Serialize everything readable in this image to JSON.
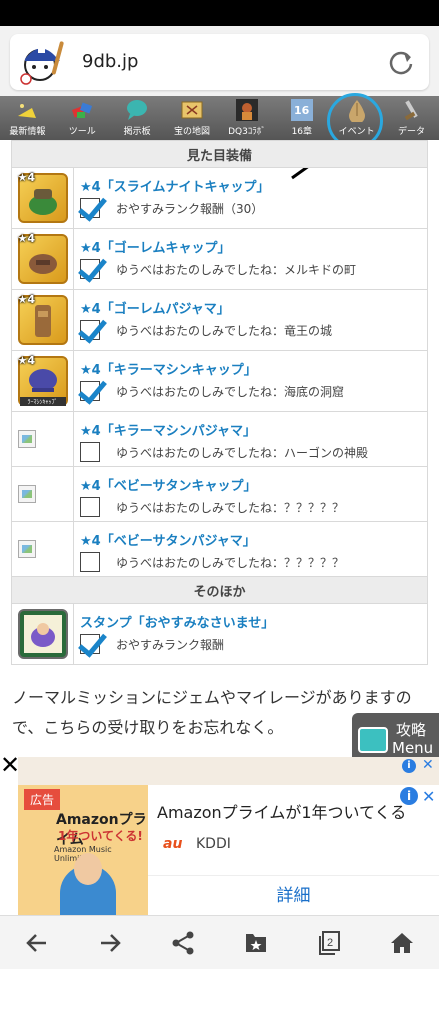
{
  "browser": {
    "url": "9db.jp"
  },
  "nav": [
    {
      "label": "最新情報",
      "icon": "news-icon"
    },
    {
      "label": "ツール",
      "icon": "tools-icon"
    },
    {
      "label": "掲示板",
      "icon": "forum-icon"
    },
    {
      "label": "宝の地図",
      "icon": "treasure-map-icon"
    },
    {
      "label": "DQ3ｺﾗﾎﾞ",
      "icon": "dq3-collab-icon"
    },
    {
      "label": "16章",
      "icon": "chapter16-icon"
    },
    {
      "label": "イベント",
      "icon": "event-icon"
    },
    {
      "label": "データ",
      "icon": "data-icon"
    }
  ],
  "sections": {
    "appearance": "見た目装備",
    "other": "そのほか"
  },
  "items": [
    {
      "title": "★4「スライムナイトキャップ」",
      "desc": "おやすみランク報酬（30）",
      "checked": true,
      "star": "★4"
    },
    {
      "title": "★4「ゴーレムキャップ」",
      "desc": "ゆうべはおたのしみでしたね：メルキドの町",
      "checked": true,
      "star": "★4"
    },
    {
      "title": "★4「ゴーレムパジャマ」",
      "desc": "ゆうべはおたのしみでしたね：竜王の城",
      "checked": true,
      "star": "★4"
    },
    {
      "title": "★4「キラーマシンキャップ」",
      "desc": "ゆうべはおたのしみでしたね：海底の洞窟",
      "checked": true,
      "star": "★4",
      "caption": "ﾗｰﾏｼﾝｷｬｯﾌﾟ"
    },
    {
      "title": "★4「キラーマシンパジャマ」",
      "desc": "ゆうべはおたのしみでしたね：ハーゴンの神殿",
      "checked": false
    },
    {
      "title": "★4「ベビーサタンキャップ」",
      "desc": "ゆうべはおたのしみでしたね：？？？？？",
      "checked": false
    },
    {
      "title": "★4「ベビーサタンパジャマ」",
      "desc": "ゆうべはおたのしみでしたね：？？？？？",
      "checked": false
    }
  ],
  "stamp": {
    "title": "スタンプ「おやすみなさいませ」",
    "desc": "おやすみランク報酬",
    "checked": true
  },
  "paragraph": "ノーマルミッションにジェムやマイレージがありますので、こちらの受け取りをお忘れなく。",
  "menu_button": {
    "top": "攻略",
    "bottom": "Menu"
  },
  "ad": {
    "label": "広告",
    "img_line1": "Amazonプライム",
    "img_line2": "1年ついてくる!",
    "img_line3": "Amazon Music Unlimited",
    "title": "Amazonプライムが1年ついてくる",
    "brand": "au",
    "advertiser": "KDDI",
    "cta": "詳細"
  },
  "bottom_bar": [
    "back-icon",
    "forward-icon",
    "share-icon",
    "bookmark-icon",
    "tabs-icon",
    "home-icon"
  ],
  "bottom_tabs_count": "2",
  "colors": {
    "link": "#1a7fc0",
    "check": "#1a84c9",
    "ring": "#2aa8e0",
    "nav": "#666666"
  }
}
